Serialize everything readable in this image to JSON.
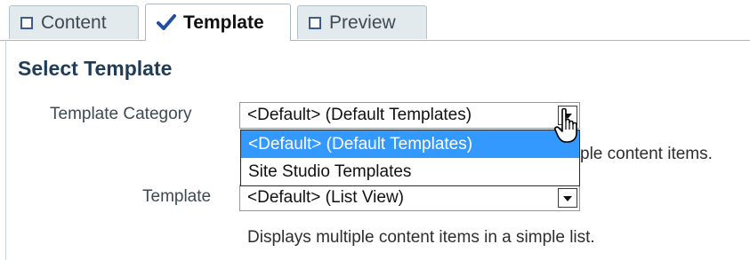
{
  "tabs": [
    {
      "label": "Content",
      "icon": "checkbox-icon",
      "active": false
    },
    {
      "label": "Template",
      "icon": "checkmark-icon",
      "active": true
    },
    {
      "label": "Preview",
      "icon": "checkbox-icon",
      "active": false
    }
  ],
  "section_title": "Select Template",
  "category_field": {
    "label": "Template Category",
    "value": "<Default> (Default Templates)",
    "description_visible_part": "ple content items."
  },
  "dropdown": {
    "options": [
      "<Default> (Default Templates)",
      "Site Studio Templates"
    ],
    "highlighted": "<Default> (Default Templates)"
  },
  "template_field": {
    "label": "Template",
    "value": "<Default> (List View)",
    "description": "Displays multiple content items in a simple list."
  },
  "colors": {
    "accent": "#3399ff",
    "title": "#1f3d58",
    "tab_bg": "#e3eaee",
    "checkbox": "#3d5d92",
    "checkmark": "#1f4f9e"
  }
}
